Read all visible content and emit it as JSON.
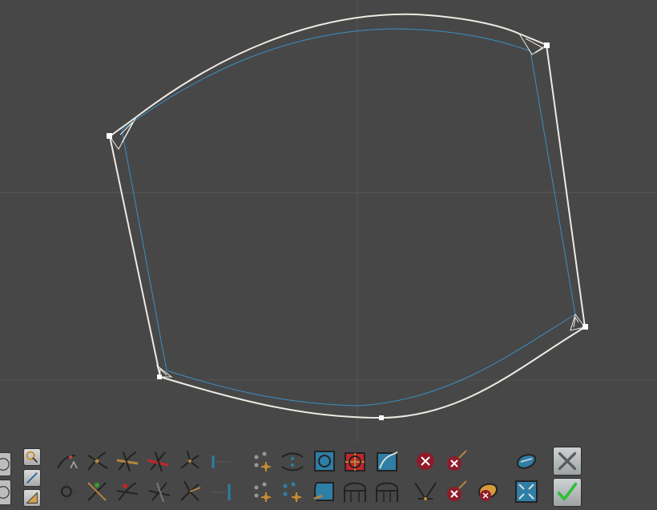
{
  "viewport": {
    "background": "#474747",
    "grid_color": "#5a5a5a",
    "curve_color": "#efeae2",
    "offset_color": "#3a8fc4",
    "handle_color": "#ffffff"
  },
  "toolbar": {
    "rows": 2,
    "accent": {
      "brown": "#b5843f",
      "red": "#c0262a",
      "teal": "#2f7ea6",
      "green_check": "#2fbf3a",
      "cancel_gray": "#5a5a5a"
    },
    "left_panel": [
      "orbit-icon",
      "zoom-icon",
      "pan-icon",
      "ruler-icon",
      "ruler-angle-icon"
    ],
    "tools": [
      "curve-tangent-icon",
      "cross-curves-icon",
      "cross-curves-brown-icon",
      "cross-curves-red-icon",
      "pinwheel-icon",
      "dimension-icon",
      "points-cluster-icon",
      "curve-spread-icon",
      "box-rotate-icon",
      "box-cut-icon",
      "box-sweep-icon",
      "delete-icon",
      "delete-line-icon",
      "surface-patch-icon",
      "move-gizmo-icon",
      "cross-curves-green-icon",
      "cross-curves-red-icon",
      "cross-curves-gray-icon",
      "pinwheel-brown-icon",
      "dimension-vertical-icon",
      "points-add-icon",
      "points-spread-icon",
      "box-rounded-icon",
      "arch-icon",
      "arch-grid-icon",
      "merge-curves-icon",
      "delete-line-icon",
      "delete-patch-icon",
      "fit-frame-icon"
    ],
    "actions": [
      "cancel-icon",
      "confirm-icon"
    ]
  }
}
